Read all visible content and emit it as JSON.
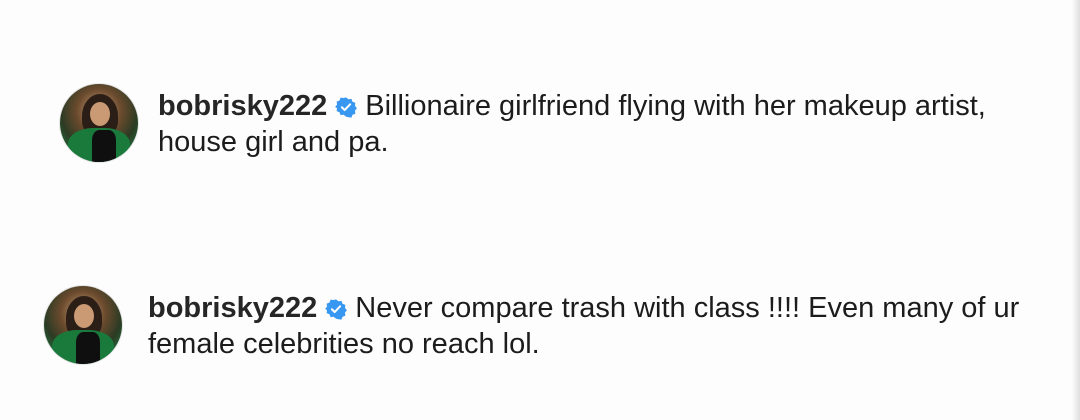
{
  "comments": [
    {
      "username": "bobrisky222",
      "text": "Billionaire girlfriend flying with her makeup artist, house girl and pa.",
      "verified": true
    },
    {
      "username": "bobrisky222",
      "text": "Never compare trash with class !!!! Even many of ur female celebrities no reach lol.",
      "verified": true
    }
  ],
  "colors": {
    "verified_badge": "#3897f0",
    "text": "#262626",
    "background": "#fdfdfd"
  },
  "icons": {
    "verified": "verified-badge-icon",
    "avatar": "profile-avatar"
  }
}
